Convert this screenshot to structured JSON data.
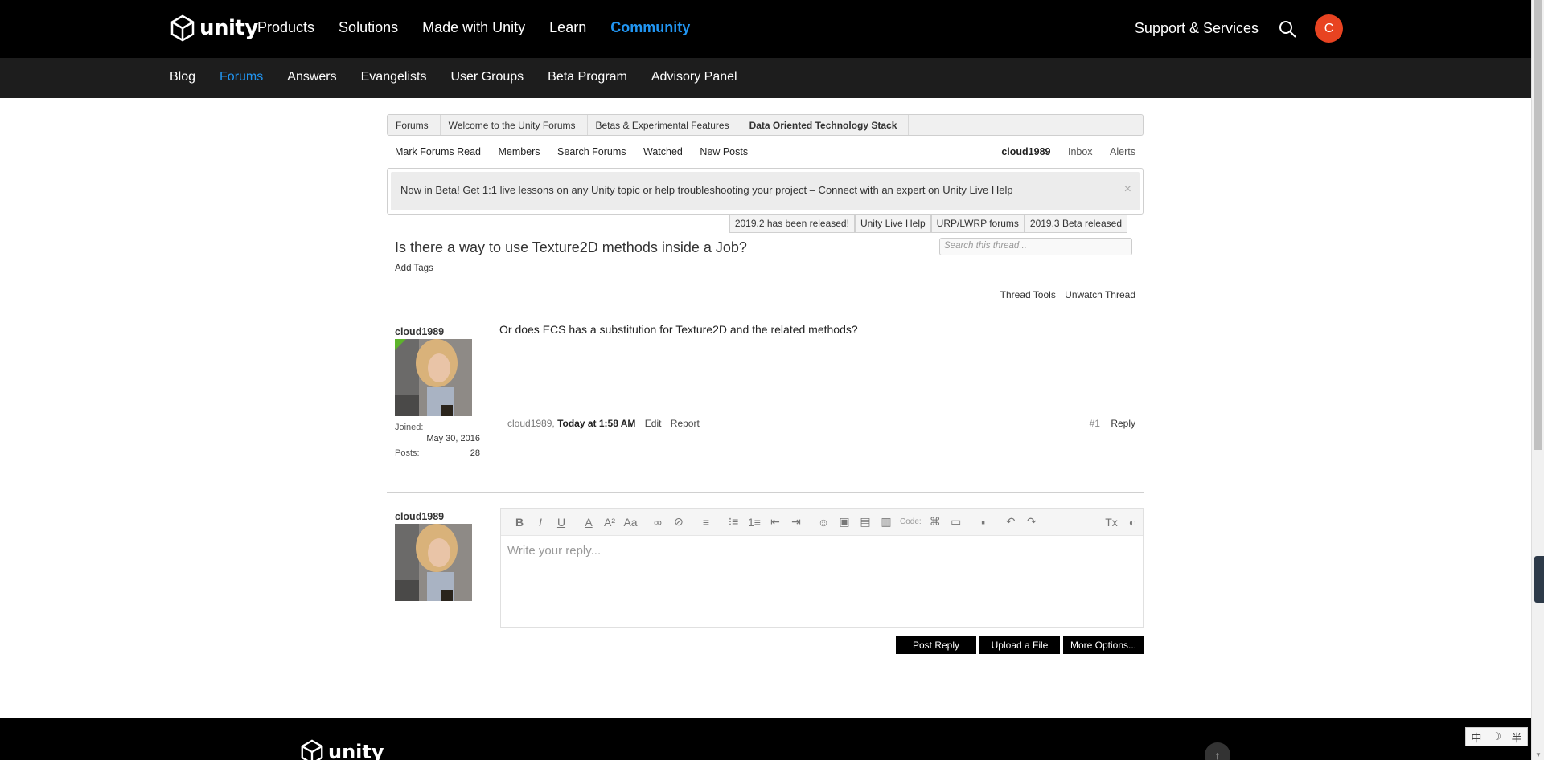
{
  "topnav": {
    "logo_text": "unity",
    "links": [
      "Products",
      "Solutions",
      "Made with Unity",
      "Learn",
      "Community"
    ],
    "support": "Support & Services",
    "avatar_letter": "C"
  },
  "subnav": {
    "links": [
      "Blog",
      "Forums",
      "Answers",
      "Evangelists",
      "User Groups",
      "Beta Program",
      "Advisory Panel"
    ]
  },
  "breadcrumb": [
    "Forums",
    "Welcome to the Unity Forums",
    "Betas & Experimental Features",
    "Data Oriented Technology Stack"
  ],
  "forum_nav": {
    "left": [
      "Mark Forums Read",
      "Members",
      "Search Forums",
      "Watched",
      "New Posts"
    ],
    "username": "cloud1989",
    "right": [
      "Inbox",
      "Alerts"
    ]
  },
  "notice": {
    "text": "Now in Beta! Get 1:1 live lessons on any Unity topic or help troubleshooting your project – Connect with an expert on Unity Live Help",
    "close": "×",
    "tabs": [
      "2019.2 has been released!",
      "Unity Live Help",
      "URP/LWRP forums",
      "2019.3 Beta released"
    ]
  },
  "thread": {
    "title": "Is there a way to use Texture2D methods inside a Job?",
    "add_tags": "Add Tags",
    "search_placeholder": "Search this thread...",
    "tools": "Thread Tools",
    "unwatch": "Unwatch Thread"
  },
  "post": {
    "username": "cloud1989",
    "joined_label": "Joined:",
    "joined_value": "May 30, 2016",
    "posts_label": "Posts:",
    "posts_value": "28",
    "message": "Or does ECS has a substitution for Texture2D and the related methods?",
    "author": "cloud1989,",
    "date": "Today at 1:58 AM",
    "edit": "Edit",
    "report": "Report",
    "number": "#1",
    "reply": "Reply"
  },
  "reply_box": {
    "username": "cloud1989",
    "placeholder": "Write your reply...",
    "code_label": "Code:",
    "post_reply": "Post Reply",
    "upload": "Upload a File",
    "more": "More Options..."
  },
  "footer": {
    "logo_text": "unity"
  },
  "ime": [
    "中",
    "☽",
    "半"
  ]
}
